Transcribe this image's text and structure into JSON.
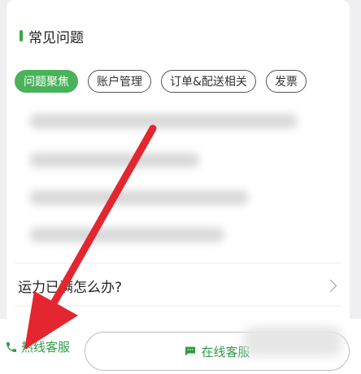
{
  "faq": {
    "title": "常见问题",
    "tabs": [
      {
        "label": "问题聚焦",
        "active": true
      },
      {
        "label": "账户管理",
        "active": false
      },
      {
        "label": "订单&配送相关",
        "active": false
      },
      {
        "label": "发票",
        "active": false
      }
    ],
    "items": [
      {
        "text": "运力已满怎么办?"
      }
    ]
  },
  "bottom": {
    "hotline_label": "热线客服",
    "online_label": "在线客服"
  },
  "colors": {
    "accent": "#4ab25a",
    "text_green": "#2e9a45",
    "annotation_arrow": "#e3262f"
  },
  "icons": {
    "hotline": "phone-icon",
    "online": "chat-bubble-icon",
    "row": "chevron-right-icon"
  }
}
